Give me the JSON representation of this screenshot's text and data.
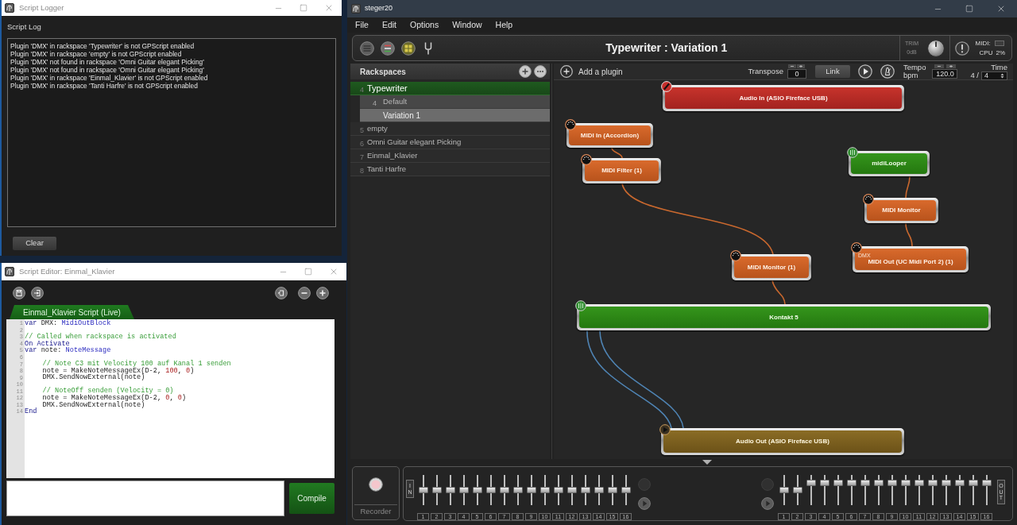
{
  "script_logger": {
    "title": "Script Logger",
    "heading": "Script Log",
    "log_lines": [
      "Plugin 'DMX' in rackspace 'Typewriter' is not GPScript enabled",
      "Plugin 'DMX' in rackspace 'empty' is not GPScript enabled",
      "Plugin 'DMX' not found in rackspace 'Omni Guitar elegant Picking'",
      "Plugin 'DMX' not found in rackspace 'Omni Guitar elegant Picking'",
      "Plugin 'DMX' in rackspace 'Einmal_Klavier' is not GPScript enabled",
      "Plugin 'DMX' in rackspace 'Tanti Harfre' is not GPScript enabled"
    ],
    "buttons": [
      "Clear"
    ]
  },
  "script_editor": {
    "title": "Script Editor: Einmal_Klavier",
    "tabs": [
      {
        "label": "Einmal_Klavier Script (Live)",
        "selected": true
      }
    ],
    "code_lines": [
      {
        "number": "1",
        "indented": false,
        "tokens": [
          {
            "kind": "keyword",
            "text": "var"
          },
          {
            "kind": "plain",
            "text": " DMX: "
          },
          {
            "kind": "type",
            "text": "MidiOutBlock"
          }
        ]
      },
      {
        "number": "2"
      },
      {
        "number": "3",
        "indented": false,
        "tokens": [
          {
            "kind": "comment",
            "text": "// Called when rackspace is activated"
          }
        ]
      },
      {
        "number": "4",
        "indented": false,
        "tokens": [
          {
            "kind": "keyword",
            "text": "On Activate"
          }
        ]
      },
      {
        "number": "5",
        "indented": false,
        "tokens": [
          {
            "kind": "keyword",
            "text": "var"
          },
          {
            "kind": "plain",
            "text": " note: "
          },
          {
            "kind": "type",
            "text": "NoteMessage"
          }
        ]
      },
      {
        "number": "6"
      },
      {
        "number": "7",
        "indented": true,
        "tokens": [
          {
            "kind": "comment",
            "text": "// Note C3 mit Velocity 100 auf Kanal 1 senden"
          }
        ]
      },
      {
        "number": "8",
        "indented": true,
        "tokens": [
          {
            "kind": "plain",
            "text": "note = MakeNoteMessageEx(D-2, "
          },
          {
            "kind": "number",
            "text": "100"
          },
          {
            "kind": "plain",
            "text": ", "
          },
          {
            "kind": "number",
            "text": "0"
          },
          {
            "kind": "plain",
            "text": ")"
          }
        ]
      },
      {
        "number": "9",
        "indented": true,
        "tokens": [
          {
            "kind": "plain",
            "text": "DMX.SendNowExternal(note)"
          }
        ]
      },
      {
        "number": "10"
      },
      {
        "number": "11",
        "indented": true,
        "tokens": [
          {
            "kind": "comment",
            "text": "// NoteOff senden (Velocity = 0)"
          }
        ]
      },
      {
        "number": "12",
        "indented": true,
        "tokens": [
          {
            "kind": "plain",
            "text": "note = MakeNoteMessageEx(D-2, "
          },
          {
            "kind": "number",
            "text": "0"
          },
          {
            "kind": "plain",
            "text": ", "
          },
          {
            "kind": "number",
            "text": "0"
          },
          {
            "kind": "plain",
            "text": ")"
          }
        ]
      },
      {
        "number": "13",
        "indented": true,
        "tokens": [
          {
            "kind": "plain",
            "text": "DMX.SendNowExternal(note)"
          }
        ]
      },
      {
        "number": "14",
        "indented": false,
        "tokens": [
          {
            "kind": "keyword",
            "text": "End"
          }
        ]
      }
    ],
    "buttons": [
      "Compile"
    ]
  },
  "main_window": {
    "title": "steger20",
    "menu": [
      "File",
      "Edit",
      "Options",
      "Window",
      "Help"
    ],
    "header": {
      "title": "Typewriter : Variation 1",
      "trim_label": "TRIM",
      "trim_value": "0dB",
      "midi_label": "MIDI:",
      "cpu_label": "CPU",
      "cpu_value": "2%"
    },
    "rackspaces": {
      "title": "Rackspaces",
      "items": [
        {
          "number": "4",
          "name": "Typewriter",
          "selected": true,
          "children": [
            {
              "number": "4",
              "name": "Default",
              "selected": false
            },
            {
              "name": "Variation 1",
              "selected": true
            }
          ]
        },
        {
          "number": "5",
          "name": "empty",
          "selected": false
        },
        {
          "number": "6",
          "name": "Omni Guitar elegant Picking",
          "selected": false
        },
        {
          "number": "7",
          "name": "Einmal_Klavier",
          "selected": false
        },
        {
          "number": "8",
          "name": "Tanti Harfre",
          "selected": false
        }
      ]
    },
    "toolbar": {
      "add_plugin": "Add a plugin",
      "transpose_label": "Transpose",
      "transpose_value": "0",
      "link": "Link",
      "tempo_label": "Tempo",
      "bpm_label": "bpm",
      "tempo_value": "120.0",
      "time_label": "Time",
      "time_numerator": "4 /",
      "time_denominator": "4"
    },
    "nodes": [
      {
        "label": "Audio In (ASIO Fireface USB)",
        "kind": "audio_in"
      },
      {
        "label": "MIDI In (Accordion)",
        "kind": "midi"
      },
      {
        "label": "MIDI Filter (1)",
        "kind": "midi"
      },
      {
        "label": "midiLooper",
        "kind": "plugin"
      },
      {
        "label": "MIDI Monitor",
        "kind": "midi"
      },
      {
        "label": "MIDI Monitor (1)",
        "kind": "midi"
      },
      {
        "label": "MIDI Out (UC Midi Port 2) (1)",
        "kind": "midi",
        "sublabel": "DMX"
      },
      {
        "label": "Kontakt 5",
        "kind": "plugin"
      },
      {
        "label": "Audio Out (ASIO Fireface USB)",
        "kind": "audio_out"
      }
    ],
    "mixer": {
      "recorder_label": "Recorder",
      "input_label": "IN",
      "inputs": [
        {
          "label": "1",
          "level": 0.5
        },
        {
          "label": "2",
          "level": 0.5
        },
        {
          "label": "3",
          "level": 0.5
        },
        {
          "label": "4",
          "level": 0.5
        },
        {
          "label": "5",
          "level": 0.5
        },
        {
          "label": "6",
          "level": 0.5
        },
        {
          "label": "7",
          "level": 0.5
        },
        {
          "label": "8",
          "level": 0.5
        },
        {
          "label": "9",
          "level": 0.5
        },
        {
          "label": "10",
          "level": 0.5
        },
        {
          "label": "11",
          "level": 0.5
        },
        {
          "label": "12",
          "level": 0.5
        },
        {
          "label": "13",
          "level": 0.5
        },
        {
          "label": "14",
          "level": 0.5
        },
        {
          "label": "15",
          "level": 0.5
        },
        {
          "label": "16",
          "level": 0.5
        }
      ],
      "output_label": "OUT",
      "outputs": [
        {
          "label": "1",
          "level": 0.5
        },
        {
          "label": "2",
          "level": 0.5
        },
        {
          "label": "3",
          "level": 0.8
        },
        {
          "label": "4",
          "level": 0.8
        },
        {
          "label": "5",
          "level": 0.8
        },
        {
          "label": "6",
          "level": 0.8
        },
        {
          "label": "7",
          "level": 0.8
        },
        {
          "label": "8",
          "level": 0.8
        },
        {
          "label": "9",
          "level": 0.8
        },
        {
          "label": "10",
          "level": 0.8
        },
        {
          "label": "11",
          "level": 0.8
        },
        {
          "label": "12",
          "level": 0.8
        },
        {
          "label": "13",
          "level": 0.8
        },
        {
          "label": "14",
          "level": 0.8
        },
        {
          "label": "15",
          "level": 0.8
        },
        {
          "label": "16",
          "level": 0.8
        }
      ]
    }
  }
}
